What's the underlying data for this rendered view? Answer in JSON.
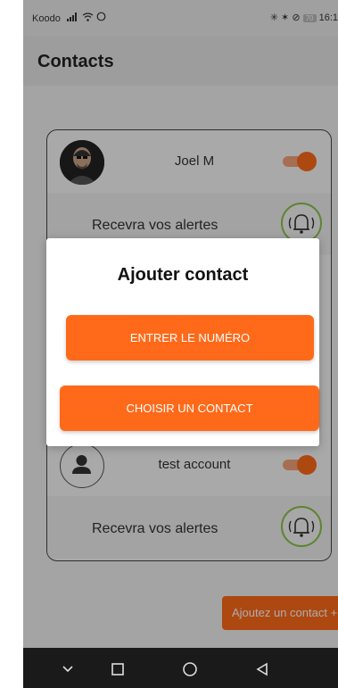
{
  "status_bar": {
    "carrier": "Koodo",
    "right_text": "✳ ✶ ⊘ 70 16:1",
    "battery": "70",
    "time": "16:1"
  },
  "header": {
    "title": "Contacts"
  },
  "contacts": [
    {
      "name": "Joel M",
      "alert_label": "Recevra vos alertes",
      "enabled": true
    },
    {
      "name": "test account",
      "alert_label": "Recevra vos alertes",
      "enabled": true
    }
  ],
  "add_contact_button": {
    "label": "Ajoutez un contact +"
  },
  "dialog": {
    "title": "Ajouter contact",
    "enter_number_label": "ENTRER LE NUMÉRO",
    "choose_contact_label": "CHOISIR UN CONTACT"
  },
  "colors": {
    "accent": "#ff6a1a",
    "bell_ring": "#8bc34a"
  },
  "icons": {
    "nav": [
      "chevron-down-icon",
      "square-icon",
      "circle-icon",
      "back-triangle-icon"
    ],
    "status": [
      "signal-icon",
      "wifi-icon",
      "whatsapp-icon",
      "battery-icon"
    ]
  }
}
